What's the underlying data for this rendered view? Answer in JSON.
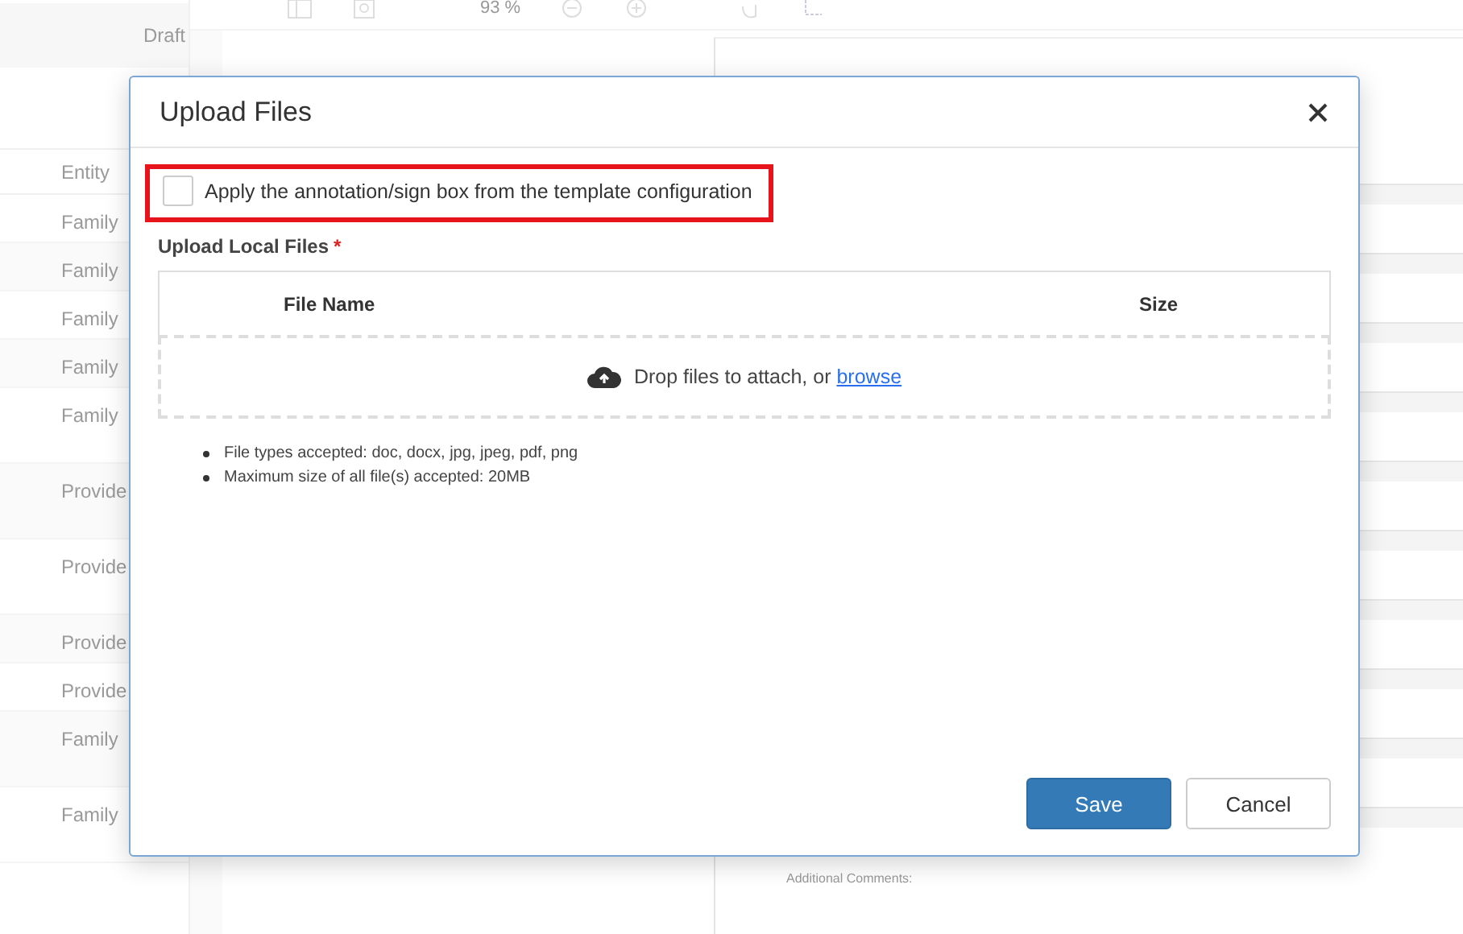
{
  "background": {
    "list_header": "Draft",
    "column_header": "Entity",
    "rows": [
      {
        "entity": "Family",
        "kind": "short"
      },
      {
        "entity": "Family",
        "kind": "short"
      },
      {
        "entity": "Family",
        "kind": "short"
      },
      {
        "entity": "Family",
        "kind": "short"
      },
      {
        "entity": "Family",
        "kind": "tall"
      },
      {
        "entity": "Provide",
        "kind": "tall"
      },
      {
        "entity": "Provide",
        "kind": "tall"
      },
      {
        "entity": "Provide",
        "kind": "short"
      },
      {
        "entity": "Provide",
        "kind": "short"
      },
      {
        "entity": "Family",
        "kind": "tall"
      },
      {
        "entity": "Family",
        "kind": "tall"
      }
    ],
    "zoom": "93 %",
    "document_label": "Additional Comments:"
  },
  "dialog": {
    "title": "Upload Files",
    "template_option": {
      "label": "Apply the annotation/sign box from the template configuration",
      "checked": false,
      "highlighted": true
    },
    "section_label": "Upload Local Files",
    "required_mark": "*",
    "columns": [
      "File Name",
      "Size"
    ],
    "dropzone": {
      "text": "Drop files to attach, or ",
      "link": "browse"
    },
    "notes": [
      "File types accepted: doc, docx, jpg, jpeg, pdf, png",
      "Maximum size of all file(s) accepted: 20MB"
    ],
    "buttons": [
      {
        "label": "Save",
        "kind": "primary"
      },
      {
        "label": "Cancel",
        "kind": "secondary"
      }
    ]
  }
}
